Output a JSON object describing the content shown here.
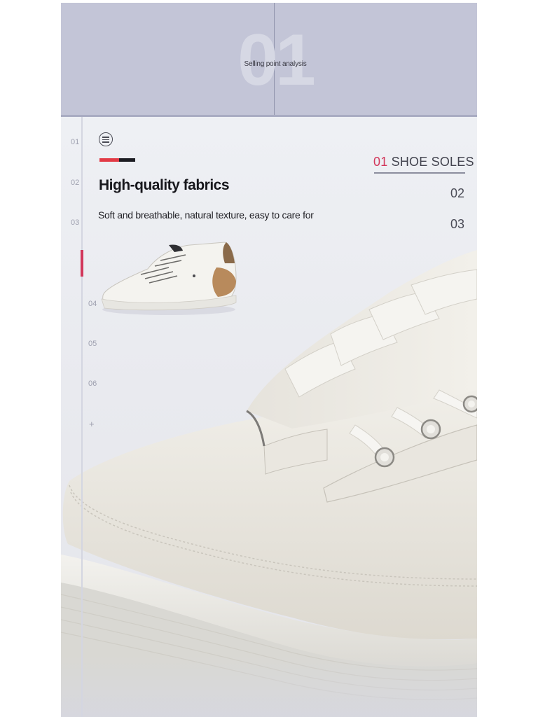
{
  "banner": {
    "big_number": "01",
    "subtitle": "Selling point analysis"
  },
  "timeline": {
    "items": [
      "01",
      "02",
      "03",
      "04",
      "05",
      "06",
      "+"
    ],
    "active_index": 2,
    "accent_color": "#d2375b"
  },
  "feature": {
    "menu_icon": "menu-lines-icon",
    "heading": "High-quality fabrics",
    "description": "Soft and breathable, natural texture, easy to care for"
  },
  "tabs": {
    "active_number": "01",
    "active_label": "SHOE SOLES",
    "items": [
      "02",
      "03"
    ]
  },
  "colors": {
    "banner": "#c3c5d7",
    "background": "#ebecf1",
    "accent_red": "#e23a45",
    "accent_black": "#1c1c22"
  }
}
